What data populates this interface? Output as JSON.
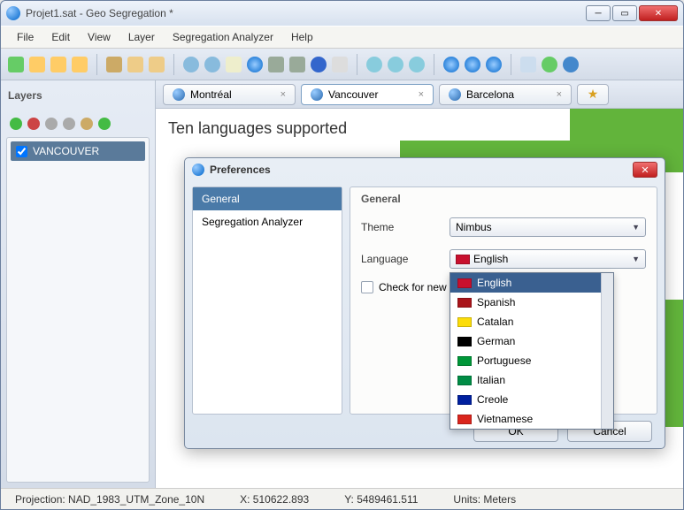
{
  "window": {
    "title": "Projet1.sat - Geo Segregation *"
  },
  "menu": {
    "file": "File",
    "edit": "Edit",
    "view": "View",
    "layer": "Layer",
    "seg": "Segregation Analyzer",
    "help": "Help"
  },
  "sidebar": {
    "title": "Layers",
    "layer0": "VANCOUVER"
  },
  "tabs": {
    "t0": "Montréal",
    "t1": "Vancouver",
    "t2": "Barcelona"
  },
  "canvas": {
    "heading": "Ten languages supported"
  },
  "status": {
    "projection": "Projection: NAD_1983_UTM_Zone_10N",
    "x": "X: 510622.893",
    "y": "Y: 5489461.511",
    "units": "Units: Meters"
  },
  "dialog": {
    "title": "Preferences",
    "nav": {
      "general": "General",
      "seg": "Segregation Analyzer"
    },
    "panel_title": "General",
    "theme_label": "Theme",
    "theme_value": "Nimbus",
    "lang_label": "Language",
    "lang_value": "English",
    "check_label": "Check for new",
    "ok": "OK",
    "cancel": "Cancel",
    "languages": {
      "en": "English",
      "es": "Spanish",
      "ca": "Catalan",
      "de": "German",
      "pt": "Portuguese",
      "it": "Italian",
      "ht": "Creole",
      "vi": "Vietnamese"
    },
    "flag_color": {
      "en": "#c8102e",
      "es": "#aa151b",
      "ca": "#fcdd09",
      "de": "#000000",
      "pt": "#009739",
      "it": "#008c45",
      "ht": "#00209f",
      "vi": "#da251d"
    }
  }
}
